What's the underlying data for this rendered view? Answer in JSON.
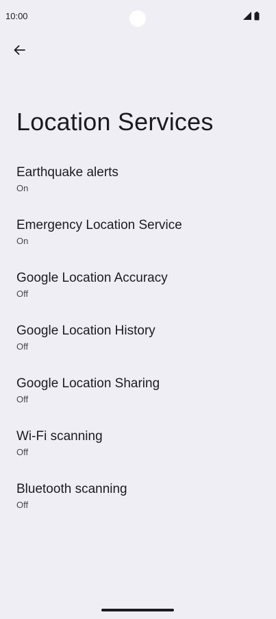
{
  "status_bar": {
    "time": "10:00",
    "icons": [
      "signal-icon",
      "battery-icon"
    ]
  },
  "header": {
    "back_icon": "arrow-back-icon"
  },
  "page": {
    "title": "Location Services"
  },
  "items": [
    {
      "title": "Earthquake alerts",
      "summary": "On"
    },
    {
      "title": "Emergency Location Service",
      "summary": "On"
    },
    {
      "title": "Google Location Accuracy",
      "summary": "Off"
    },
    {
      "title": "Google Location History",
      "summary": "Off"
    },
    {
      "title": "Google Location Sharing",
      "summary": "Off"
    },
    {
      "title": "Wi-Fi scanning",
      "summary": "Off"
    },
    {
      "title": "Bluetooth scanning",
      "summary": "Off"
    }
  ],
  "colors": {
    "background": "#f0eef5",
    "text_primary": "#1b1b1f",
    "text_secondary": "#46464f"
  }
}
